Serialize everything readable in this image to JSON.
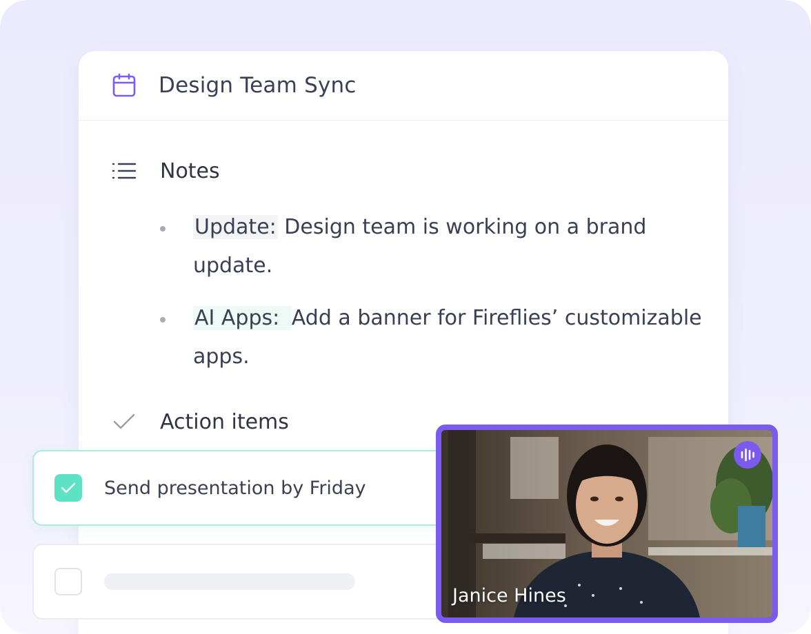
{
  "meeting": {
    "title": "Design Team Sync",
    "icon": "calendar-icon",
    "accent_color": "#7b5af0"
  },
  "notes": {
    "heading": "Notes",
    "icon": "list-icon",
    "items": [
      {
        "tag": "Update:",
        "text": " Design team is working on a brand update."
      },
      {
        "tag": "AI Apps: ",
        "text": " Add a banner for Fireflies’ customizable apps."
      }
    ]
  },
  "action_items": {
    "heading": "Action items",
    "icon": "check-icon",
    "tasks": [
      {
        "text": "Send presentation by Friday",
        "checked": true
      },
      {
        "text": "",
        "checked": false
      }
    ]
  },
  "video": {
    "participant_name": "Janice Hines",
    "speaking_icon": "audio-waveform-icon",
    "border_color": "#7b5af0"
  }
}
